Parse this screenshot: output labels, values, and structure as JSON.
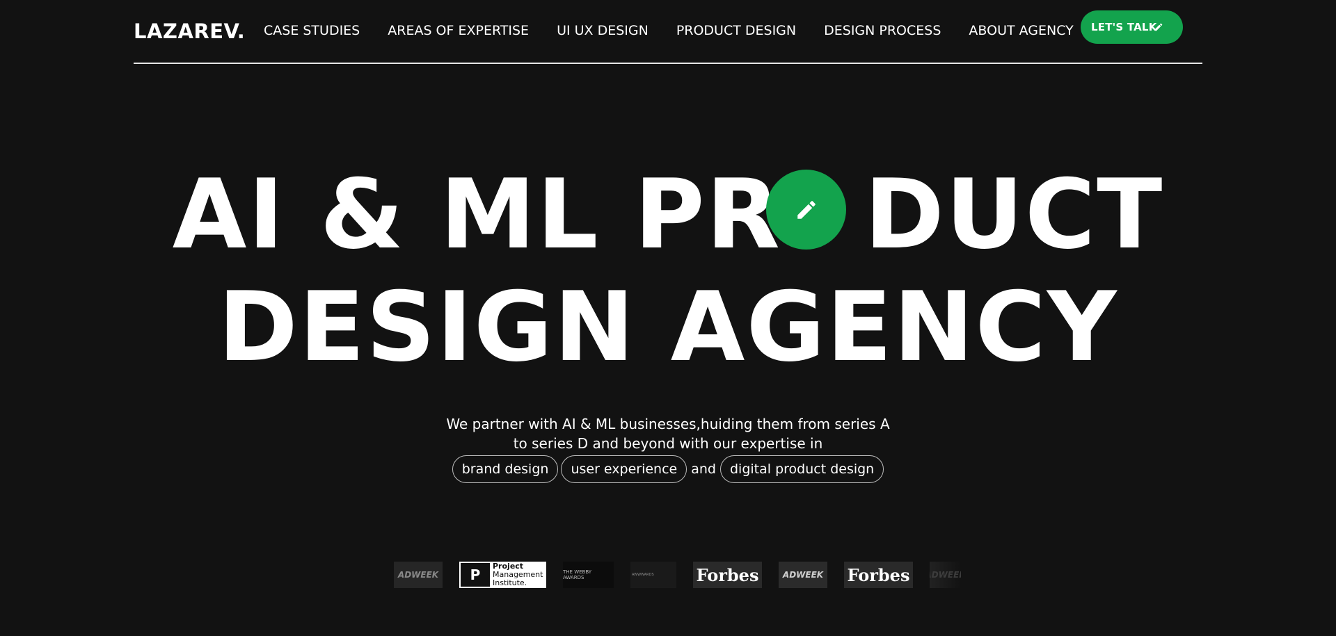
{
  "header": {
    "logo": "LAZAREV.",
    "nav": [
      {
        "label": "CASE STUDIES"
      },
      {
        "label": "AREAS OF EXPERTISE"
      },
      {
        "label": "UI UX DESIGN"
      },
      {
        "label": "PRODUCT DESIGN"
      },
      {
        "label": "DESIGN PROCESS"
      },
      {
        "label": "ABOUT AGENCY"
      }
    ],
    "cta_label": "LET'S TALK",
    "cta_icon": "pencil-icon"
  },
  "hero": {
    "line1_before": "AI & ML PR",
    "line1_hidden": "O",
    "line1_after": "DUCT",
    "line2": "DESIGN AGENCY",
    "badge_icon": "pencil-icon"
  },
  "intro": {
    "line1": "We partner with AI & ML businesses,huiding them from series A",
    "line2": "to series D and beyond with our expertise in",
    "tags": [
      "brand design",
      "user experience",
      "digital product design"
    ],
    "and": "and"
  },
  "logos": {
    "adweek": "ADWEEK",
    "pmi_line1": "Project",
    "pmi_line2": "Management",
    "pmi_line3": "Institute.",
    "webby": "THE WEBBY AWARDS",
    "awwwards": "AWWWARDS",
    "forbes": "Forbes"
  },
  "colors": {
    "background": "#121212",
    "accent": "#13a34d",
    "text": "#ffffff"
  }
}
